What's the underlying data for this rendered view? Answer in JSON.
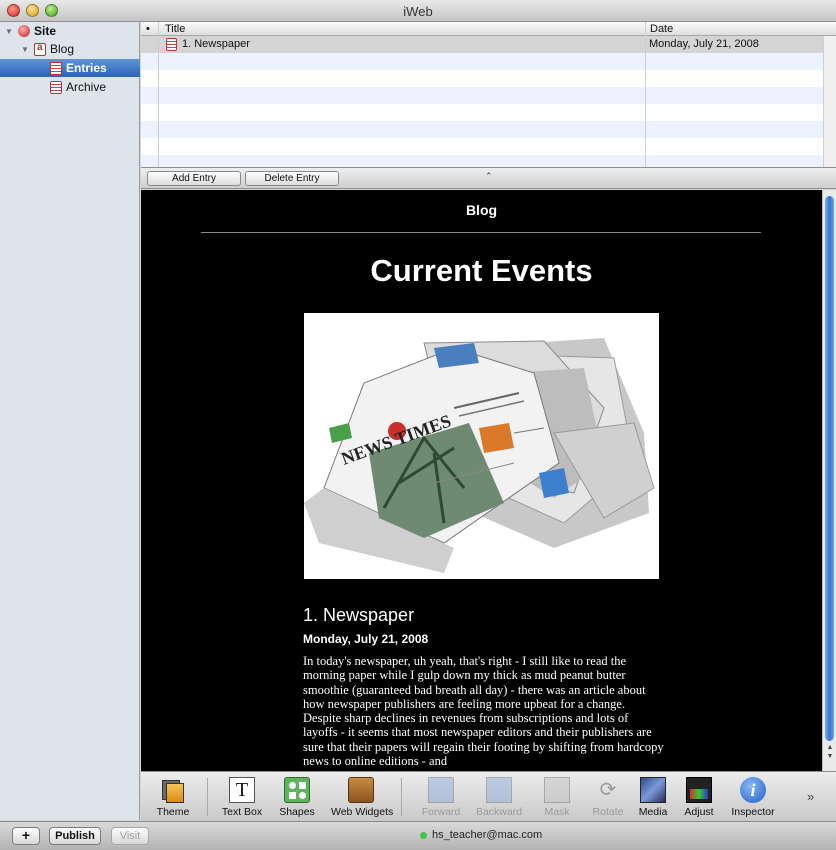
{
  "window": {
    "title": "iWeb"
  },
  "sidebar": {
    "items": [
      {
        "label": "Site",
        "icon": "site-globe-icon"
      },
      {
        "label": "Blog",
        "icon": "blog-icon"
      },
      {
        "label": "Entries",
        "icon": "entries-page-icon",
        "selected": true
      },
      {
        "label": "Archive",
        "icon": "archive-page-icon"
      }
    ]
  },
  "entries_table": {
    "columns": {
      "marker": "•",
      "title": "Title",
      "date": "Date"
    },
    "rows": [
      {
        "title": "1. Newspaper",
        "date": "Monday, July 21, 2008"
      }
    ],
    "add_label": "Add Entry",
    "delete_label": "Delete Entry",
    "collapse_glyph": "⌃"
  },
  "page": {
    "header": "Blog",
    "title": "Current Events",
    "entry_title": "1. Newspaper",
    "entry_date": "Monday, July 21, 2008",
    "entry_body": "In today's newspaper, uh yeah, that's right - I still like to read the morning paper while I gulp down my thick as mud peanut butter smoothie (guaranteed bad breath all day) -  there was an article about how newspaper publishers are feeling more upbeat for a change.  Despite sharp declines in revenues from subscriptions and lots of  layoffs - it seems that most newspaper editors and their publishers are sure that their papers will regain their footing by shifting from hardcopy news to online editions - and",
    "photo": {
      "masthead": "NEWS TIMES"
    }
  },
  "toolbar": {
    "items": [
      {
        "label": "Theme",
        "icon": "theme-icon",
        "enabled": true
      },
      {
        "label": "Text Box",
        "icon": "text-box-icon",
        "enabled": true
      },
      {
        "label": "Shapes",
        "icon": "shapes-icon",
        "enabled": true
      },
      {
        "label": "Web Widgets",
        "icon": "web-widgets-icon",
        "enabled": true
      },
      {
        "label": "Forward",
        "icon": "forward-icon",
        "enabled": false
      },
      {
        "label": "Backward",
        "icon": "backward-icon",
        "enabled": false
      },
      {
        "label": "Mask",
        "icon": "mask-icon",
        "enabled": false
      },
      {
        "label": "Rotate",
        "icon": "rotate-icon",
        "enabled": false
      },
      {
        "label": "Media",
        "icon": "media-icon",
        "enabled": true
      },
      {
        "label": "Adjust",
        "icon": "adjust-icon",
        "enabled": true
      },
      {
        "label": "Inspector",
        "icon": "inspector-icon",
        "enabled": true
      }
    ],
    "overflow_glyph": "»"
  },
  "bottombar": {
    "add_glyph": "+",
    "publish_label": "Publish",
    "visit_label": "Visit",
    "account": "hs_teacher@mac.com"
  },
  "colors": {
    "selection": "#3b73c4",
    "canvas": "#000000",
    "status_online": "#44c244"
  }
}
